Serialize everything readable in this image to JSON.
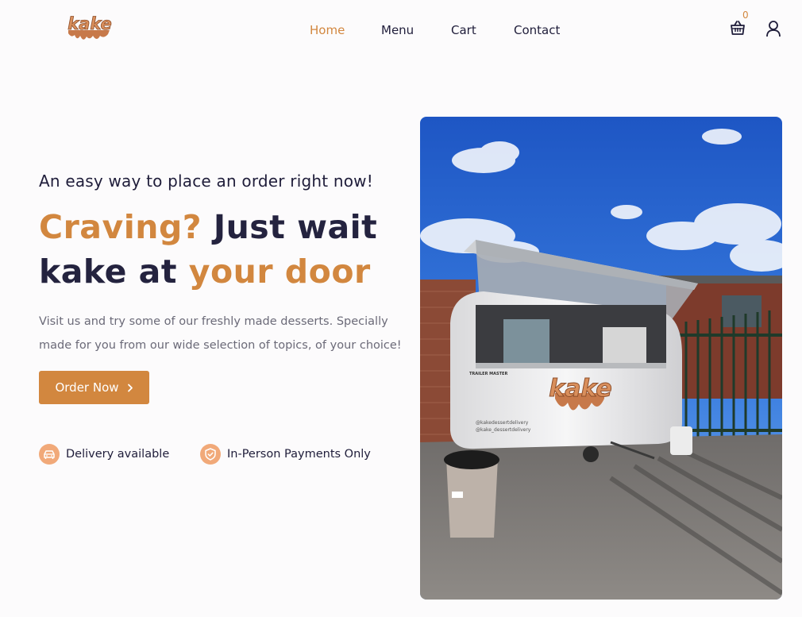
{
  "brand": {
    "logo_text": "kake"
  },
  "nav": {
    "home": "Home",
    "menu": "Menu",
    "cart": "Cart",
    "contact": "Contact"
  },
  "header_icons": {
    "cart_icon": "basket-icon",
    "cart_count": "0",
    "user_icon": "user-icon"
  },
  "hero": {
    "tagline": "An easy way to place an order right now!",
    "headline": {
      "part1": "Craving?",
      "part2": " Just wait kake at ",
      "part3": "your door"
    },
    "description": "Visit us and try some of our freshly made desserts. Specially made for you from our wide selection of topics, of your choice!",
    "cta_label": "Order Now",
    "cta_icon": "chevron-right-icon"
  },
  "features": [
    {
      "icon": "car-icon",
      "label": "Delivery available"
    },
    {
      "icon": "shield-check-icon",
      "label": "In-Person Payments Only"
    }
  ],
  "colors": {
    "accent": "#d2873f",
    "dark": "#24233f",
    "icon_bg": "#f1a979",
    "background": "#fcfbfc"
  },
  "truck_decal": {
    "brand": "kake",
    "social1": "@kakedessertdelivery",
    "social2": "@kake_dessertdelivery",
    "trailer_badge": "TRAILER MASTER"
  }
}
